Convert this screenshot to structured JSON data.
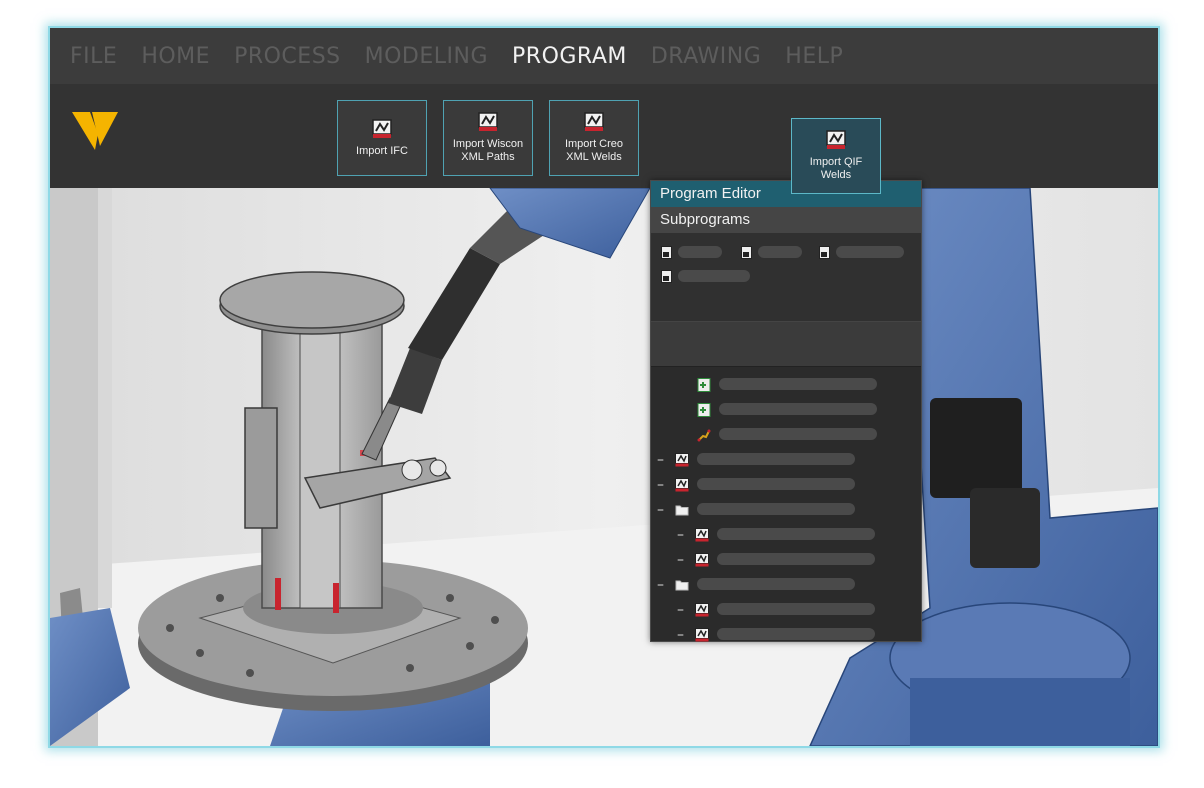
{
  "menu": {
    "items": [
      "FILE",
      "HOME",
      "PROCESS",
      "MODELING",
      "PROGRAM",
      "DRAWING",
      "HELP"
    ],
    "active": "PROGRAM"
  },
  "ribbon": {
    "import_ifc": "Import IFC",
    "import_wiscon": "Import Wiscon\nXML Paths",
    "import_creo": "Import Creo\nXML Welds",
    "import_qif": "Import QIF\nWelds"
  },
  "program_editor": {
    "title": "Program Editor",
    "subprograms_label": "Subprograms",
    "tree_items": [
      {
        "icon": "add-file-icon",
        "expander": ""
      },
      {
        "icon": "add-file-icon",
        "expander": ""
      },
      {
        "icon": "path-icon",
        "expander": ""
      },
      {
        "icon": "weld-icon",
        "expander": "–"
      },
      {
        "icon": "weld-icon",
        "expander": "–"
      },
      {
        "icon": "folder-icon",
        "expander": "–"
      },
      {
        "icon": "weld-icon",
        "expander": "–"
      },
      {
        "icon": "weld-icon",
        "expander": "–"
      },
      {
        "icon": "folder-icon",
        "expander": "–"
      },
      {
        "icon": "weld-icon",
        "expander": "–"
      },
      {
        "icon": "weld-icon",
        "expander": "–"
      }
    ]
  },
  "colors": {
    "accent": "#f5b400",
    "weld_red": "#c8242e",
    "panel_header": "#1f5f70",
    "robot_blue": "#4a6fae",
    "frame_glow": "#8fd9e6"
  }
}
